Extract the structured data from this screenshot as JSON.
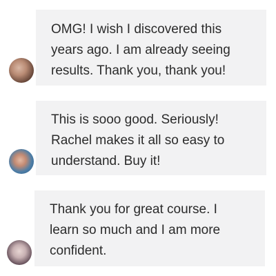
{
  "messages": [
    {
      "avatar_icon": "user-avatar-photo",
      "lines": [
        "OMG! I wish I discovered this",
        "years ago. I am already seeing",
        "results. Thank you, thank you!"
      ]
    },
    {
      "avatar_icon": "user-avatar-photo",
      "lines": [
        "This is sooo good. Seriously!",
        "Rachel makes it all so easy to",
        "understand. Buy it!"
      ]
    },
    {
      "avatar_icon": "user-avatar-photo",
      "lines": [
        "Thank you for great course. I",
        "learn so much and I am more",
        "confident."
      ]
    }
  ],
  "colors": {
    "bubble_bg": "#f2f2f3",
    "text": "#2b2b2b",
    "page_bg": "#ffffff"
  }
}
